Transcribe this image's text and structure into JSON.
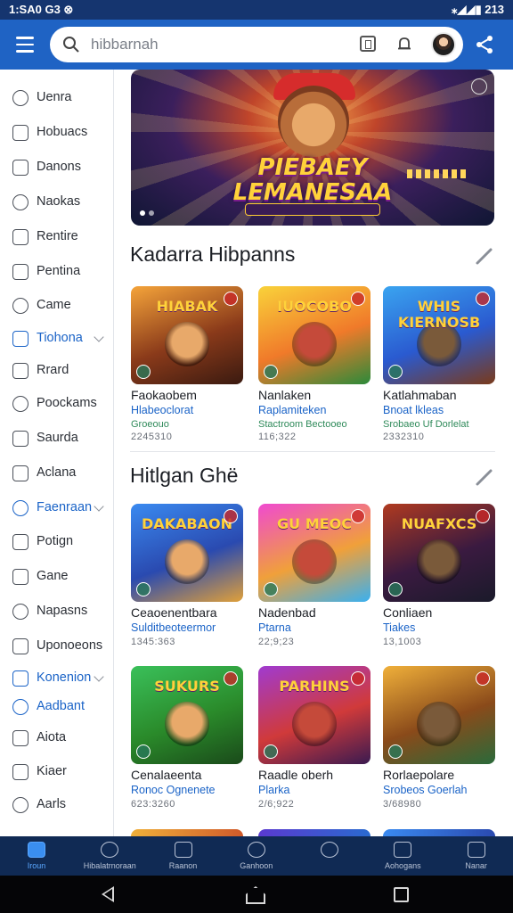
{
  "status": {
    "time": "1:SA0 G3 ⊗",
    "battery": "⁎◢◢▮ 213"
  },
  "search": {
    "value": "hibbarnah"
  },
  "sidebar": {
    "items": [
      {
        "label": "Uenra",
        "active": false,
        "chevron": false
      },
      {
        "label": "Hobuacs",
        "active": false,
        "chevron": false
      },
      {
        "label": "Danons",
        "active": false,
        "chevron": false
      },
      {
        "label": "Naokas",
        "active": false,
        "chevron": false
      },
      {
        "label": "Rentire",
        "active": false,
        "chevron": false
      },
      {
        "label": "Pentina",
        "active": false,
        "chevron": false
      },
      {
        "label": "Came",
        "active": false,
        "chevron": false
      },
      {
        "label": "Tiohona",
        "active": true,
        "chevron": true
      },
      {
        "label": "Rrard",
        "active": false,
        "chevron": false
      },
      {
        "label": "Poockams",
        "active": false,
        "chevron": false
      },
      {
        "label": "Saurda",
        "active": false,
        "chevron": false
      },
      {
        "label": "Aclana",
        "active": false,
        "chevron": false
      },
      {
        "label": "Faenraan",
        "active": true,
        "chevron": true
      },
      {
        "label": "Potign",
        "active": false,
        "chevron": false
      },
      {
        "label": "Gane",
        "active": false,
        "chevron": false
      },
      {
        "label": "Napasns",
        "active": false,
        "chevron": false
      },
      {
        "label": "Uponoeons",
        "active": false,
        "chevron": false
      },
      {
        "label": "Konenion",
        "active": true,
        "chevron": true
      },
      {
        "label": "Aadbant",
        "active": true,
        "chevron": false
      },
      {
        "label": "Aiota",
        "active": false,
        "chevron": false
      },
      {
        "label": "Kiaer",
        "active": false,
        "chevron": false
      },
      {
        "label": "Aarls",
        "active": false,
        "chevron": false
      }
    ]
  },
  "hero": {
    "title_line1": "PIEBAEY",
    "title_line2": "LEMANESAA"
  },
  "sections": [
    {
      "title": "Kadarra Hibpanns",
      "cards": [
        {
          "logo": "HIABAK",
          "name": "Faokaobem",
          "dev": "Hlabeoclorat",
          "genre": "Groeouo",
          "meta": "2245310"
        },
        {
          "logo": "IUOCOBO",
          "name": "Nanlaken",
          "dev": "Raplamiteken",
          "genre": "Stactroom Bectooeo",
          "meta": "116;322"
        },
        {
          "logo": "WHIS KIERNOSB",
          "name": "Katlahmaban",
          "dev": "Bnoat lkleas",
          "genre": "Srobaeo Uf Dorlelat",
          "meta": "2332310"
        }
      ]
    },
    {
      "title": "Hitlgan Ghë",
      "cards": [
        {
          "logo": "DAKABAON",
          "name": "Ceaoenentbara",
          "dev": "Sulditbeoteermor",
          "genre": "",
          "meta": "1345:363"
        },
        {
          "logo": "GU MEOC",
          "name": "Nadenbad",
          "dev": "Ptarna",
          "genre": "",
          "meta": "22;9;23"
        },
        {
          "logo": "NUAFXCS",
          "name": "Conliaen",
          "dev": "Tiakes",
          "genre": "",
          "meta": "13,1003"
        }
      ]
    },
    {
      "title": "",
      "cards": [
        {
          "logo": "SUKURS",
          "name": "Cenalaeenta",
          "dev": "Ronoc Ognenete",
          "genre": "",
          "meta": "623:3260"
        },
        {
          "logo": "PARHINS",
          "name": "Raadle oberh",
          "dev": "Plarka",
          "genre": "",
          "meta": "2/6;922"
        },
        {
          "logo": "",
          "name": "Rorlaepolare",
          "dev": "Srobeos Goerlah",
          "genre": "",
          "meta": "3/68980"
        }
      ]
    }
  ],
  "bottom_nav": [
    {
      "label": "Iroun",
      "active": true
    },
    {
      "label": "Hibalatrnoraan",
      "active": false
    },
    {
      "label": "Raanon",
      "active": false
    },
    {
      "label": "Ganhoon",
      "active": false
    },
    {
      "label": "",
      "active": false
    },
    {
      "label": "Aohogans",
      "active": false
    },
    {
      "label": "Nanar",
      "active": false
    }
  ]
}
